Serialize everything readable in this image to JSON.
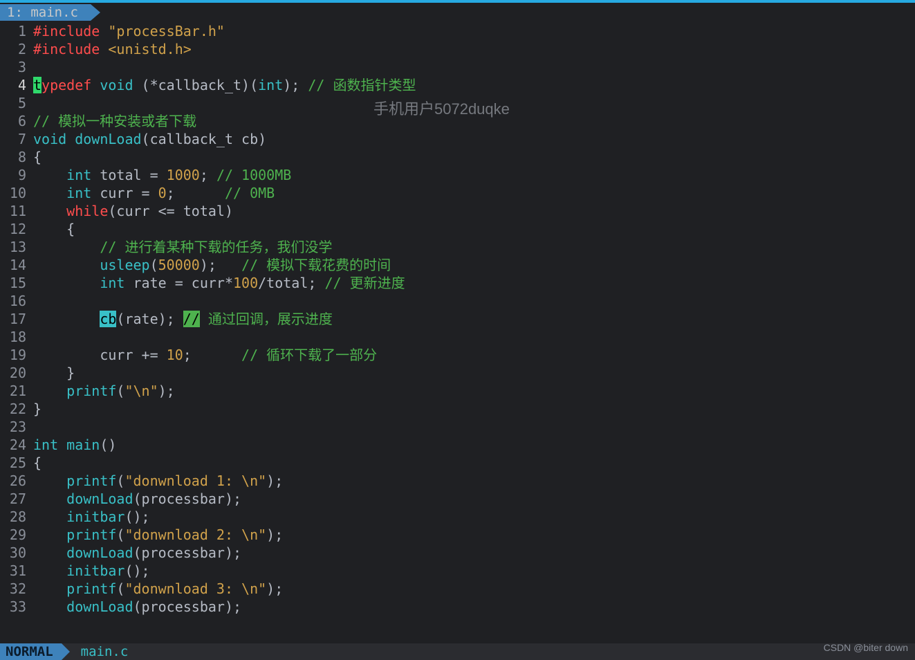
{
  "tab": {
    "label": "1: main.c"
  },
  "watermark": "手机用户5072duqke",
  "statusbar": {
    "mode": "NORMAL",
    "file": "main.c"
  },
  "credit": "CSDN @biter down",
  "lines": [
    {
      "n": 1,
      "tokens": [
        [
          "pre",
          "#include"
        ],
        [
          "id",
          " "
        ],
        [
          "str",
          "\"processBar.h\""
        ]
      ]
    },
    {
      "n": 2,
      "tokens": [
        [
          "pre",
          "#include"
        ],
        [
          "id",
          " "
        ],
        [
          "str",
          "<unistd.h>"
        ]
      ]
    },
    {
      "n": 3,
      "tokens": []
    },
    {
      "n": 4,
      "active": true,
      "tokens": [
        [
          "cursor",
          "t"
        ],
        [
          "kw",
          "ypedef"
        ],
        [
          "id",
          " "
        ],
        [
          "type",
          "void"
        ],
        [
          "id",
          " (*callback_t)("
        ],
        [
          "type",
          "int"
        ],
        [
          "id",
          "); "
        ],
        [
          "cmt",
          "// 函数指针类型"
        ]
      ]
    },
    {
      "n": 5,
      "tokens": []
    },
    {
      "n": 6,
      "tokens": [
        [
          "cmt",
          "// 模拟一种安装或者下载"
        ]
      ]
    },
    {
      "n": 7,
      "tokens": [
        [
          "type",
          "void"
        ],
        [
          "id",
          " "
        ],
        [
          "fn",
          "downLoad"
        ],
        [
          "id",
          "(callback_t cb)"
        ]
      ]
    },
    {
      "n": 8,
      "tokens": [
        [
          "id",
          "{"
        ]
      ]
    },
    {
      "n": 9,
      "tokens": [
        [
          "id",
          "    "
        ],
        [
          "type",
          "int"
        ],
        [
          "id",
          " total = "
        ],
        [
          "num",
          "1000"
        ],
        [
          "id",
          "; "
        ],
        [
          "cmt",
          "// 1000MB"
        ]
      ]
    },
    {
      "n": 10,
      "tokens": [
        [
          "id",
          "    "
        ],
        [
          "type",
          "int"
        ],
        [
          "id",
          " curr = "
        ],
        [
          "num",
          "0"
        ],
        [
          "id",
          ";      "
        ],
        [
          "cmt",
          "// 0MB"
        ]
      ]
    },
    {
      "n": 11,
      "tokens": [
        [
          "id",
          "    "
        ],
        [
          "kw",
          "while"
        ],
        [
          "id",
          "(curr <= total)"
        ]
      ]
    },
    {
      "n": 12,
      "tokens": [
        [
          "id",
          "    {"
        ]
      ]
    },
    {
      "n": 13,
      "tokens": [
        [
          "id",
          "        "
        ],
        [
          "cmt",
          "// 进行着某种下载的任务，我们没学"
        ]
      ]
    },
    {
      "n": 14,
      "tokens": [
        [
          "id",
          "        "
        ],
        [
          "fn",
          "usleep"
        ],
        [
          "id",
          "("
        ],
        [
          "num",
          "50000"
        ],
        [
          "id",
          ");   "
        ],
        [
          "cmt",
          "// 模拟下载花费的时间"
        ]
      ]
    },
    {
      "n": 15,
      "tokens": [
        [
          "id",
          "        "
        ],
        [
          "type",
          "int"
        ],
        [
          "id",
          " rate = curr*"
        ],
        [
          "num",
          "100"
        ],
        [
          "id",
          "/total; "
        ],
        [
          "cmt",
          "// 更新进度"
        ]
      ]
    },
    {
      "n": 16,
      "tokens": []
    },
    {
      "n": 17,
      "tokens": [
        [
          "id",
          "        "
        ],
        [
          "hl-cyan",
          "cb"
        ],
        [
          "id",
          "(rate); "
        ],
        [
          "hl-green",
          "//"
        ],
        [
          "cmt",
          " 通过回调，展示进度"
        ]
      ]
    },
    {
      "n": 18,
      "tokens": []
    },
    {
      "n": 19,
      "tokens": [
        [
          "id",
          "        curr += "
        ],
        [
          "num",
          "10"
        ],
        [
          "id",
          ";      "
        ],
        [
          "cmt",
          "// 循环下载了一部分"
        ]
      ]
    },
    {
      "n": 20,
      "tokens": [
        [
          "id",
          "    }"
        ]
      ]
    },
    {
      "n": 21,
      "tokens": [
        [
          "id",
          "    "
        ],
        [
          "fn",
          "printf"
        ],
        [
          "id",
          "("
        ],
        [
          "str",
          "\"\\n\""
        ],
        [
          "id",
          ");"
        ]
      ]
    },
    {
      "n": 22,
      "tokens": [
        [
          "id",
          "}"
        ]
      ]
    },
    {
      "n": 23,
      "tokens": []
    },
    {
      "n": 24,
      "tokens": [
        [
          "type",
          "int"
        ],
        [
          "id",
          " "
        ],
        [
          "fn",
          "main"
        ],
        [
          "id",
          "()"
        ]
      ]
    },
    {
      "n": 25,
      "tokens": [
        [
          "id",
          "{"
        ]
      ]
    },
    {
      "n": 26,
      "tokens": [
        [
          "id",
          "    "
        ],
        [
          "fn",
          "printf"
        ],
        [
          "id",
          "("
        ],
        [
          "str",
          "\"donwnload 1: \\n\""
        ],
        [
          "id",
          ");"
        ]
      ]
    },
    {
      "n": 27,
      "tokens": [
        [
          "id",
          "    "
        ],
        [
          "fn",
          "downLoad"
        ],
        [
          "id",
          "(processbar);"
        ]
      ]
    },
    {
      "n": 28,
      "tokens": [
        [
          "id",
          "    "
        ],
        [
          "fn",
          "initbar"
        ],
        [
          "id",
          "();"
        ]
      ]
    },
    {
      "n": 29,
      "tokens": [
        [
          "id",
          "    "
        ],
        [
          "fn",
          "printf"
        ],
        [
          "id",
          "("
        ],
        [
          "str",
          "\"donwnload 2: \\n\""
        ],
        [
          "id",
          ");"
        ]
      ]
    },
    {
      "n": 30,
      "tokens": [
        [
          "id",
          "    "
        ],
        [
          "fn",
          "downLoad"
        ],
        [
          "id",
          "(processbar);"
        ]
      ]
    },
    {
      "n": 31,
      "tokens": [
        [
          "id",
          "    "
        ],
        [
          "fn",
          "initbar"
        ],
        [
          "id",
          "();"
        ]
      ]
    },
    {
      "n": 32,
      "tokens": [
        [
          "id",
          "    "
        ],
        [
          "fn",
          "printf"
        ],
        [
          "id",
          "("
        ],
        [
          "str",
          "\"donwnload 3: \\n\""
        ],
        [
          "id",
          ");"
        ]
      ]
    },
    {
      "n": 33,
      "tokens": [
        [
          "id",
          "    "
        ],
        [
          "fn",
          "downLoad"
        ],
        [
          "id",
          "(processbar);"
        ]
      ]
    }
  ]
}
